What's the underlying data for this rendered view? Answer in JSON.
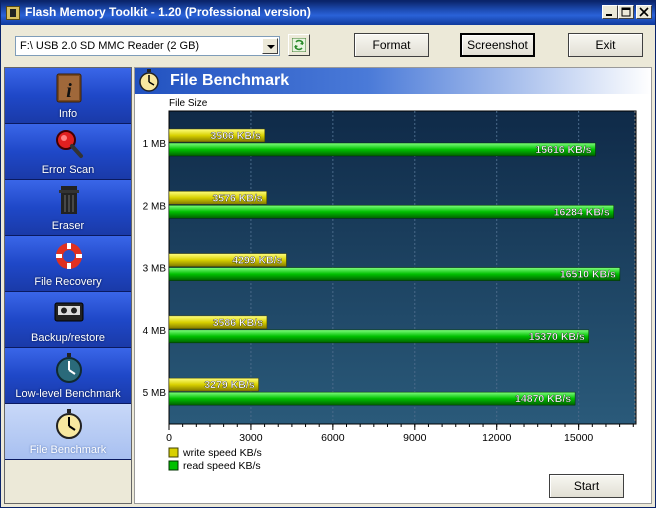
{
  "window": {
    "title": "Flash Memory Toolkit - 1.20 (Professional version)"
  },
  "toolbar": {
    "device": "F:\\ USB 2.0 SD MMC Reader (2 GB)",
    "format_label": "Format",
    "screenshot_label": "Screenshot",
    "exit_label": "Exit"
  },
  "sidebar": {
    "items": [
      {
        "label": "Info",
        "icon": "info-icon"
      },
      {
        "label": "Error Scan",
        "icon": "magnifier-icon"
      },
      {
        "label": "Eraser",
        "icon": "trash-icon"
      },
      {
        "label": "File Recovery",
        "icon": "lifebuoy-icon"
      },
      {
        "label": "Backup/restore",
        "icon": "tape-icon"
      },
      {
        "label": "Low-level Benchmark",
        "icon": "stopwatch-icon"
      },
      {
        "label": "File Benchmark",
        "icon": "stopwatch-icon"
      }
    ],
    "active": "File Benchmark"
  },
  "panel": {
    "title": "File Benchmark",
    "start_label": "Start"
  },
  "colors": {
    "write": "#d8d000",
    "read": "#00c000",
    "plot_bg": "#1a3a5a"
  },
  "chart_data": {
    "type": "bar",
    "orientation": "horizontal",
    "ylabel": "File Size",
    "categories": [
      "1 MB",
      "2 MB",
      "3 MB",
      "4 MB",
      "5 MB"
    ],
    "series": [
      {
        "name": "write speed KB/s",
        "values": [
          3506,
          3576,
          4299,
          3586,
          3279
        ],
        "labels": [
          "3506 KB/s",
          "3576 KB/s",
          "4299 KB/s",
          "3586 KB/s",
          "3279 KB/s"
        ]
      },
      {
        "name": "read speed KB/s",
        "values": [
          15616,
          16284,
          16510,
          15370,
          14870
        ],
        "labels": [
          "15616 KB/s",
          "16284 KB/s",
          "16510 KB/s",
          "15370 KB/s",
          "14870 KB/s"
        ]
      }
    ],
    "xticks": [
      "0",
      "3000",
      "6000",
      "9000",
      "12000",
      "15000"
    ],
    "xlim": [
      0,
      17100
    ],
    "grid": true,
    "legend_position": "bottom-left"
  }
}
